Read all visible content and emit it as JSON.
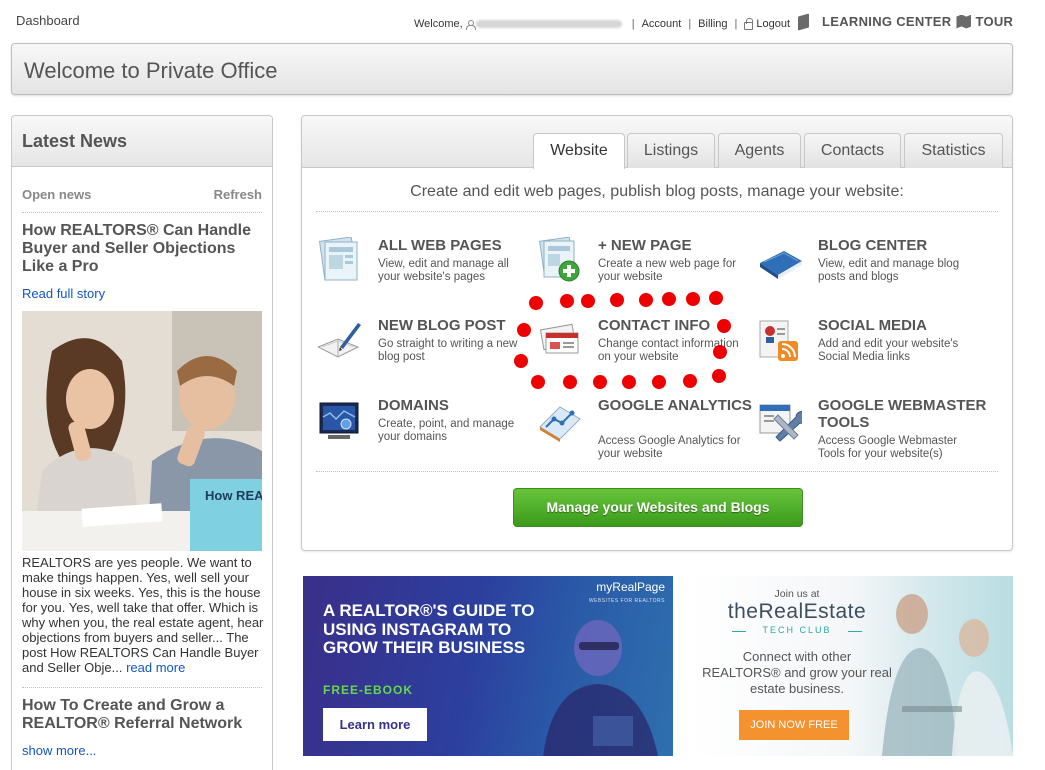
{
  "topbar": {
    "dashboard": "Dashboard",
    "welcome": "Welcome,",
    "account": "Account",
    "billing": "Billing",
    "logout": "Logout",
    "learning_center": "LEARNING CENTER",
    "tour": "TOUR"
  },
  "header": {
    "title": "Welcome to Private Office"
  },
  "news": {
    "heading": "Latest News",
    "open_news": "Open news",
    "refresh": "Refresh",
    "items": [
      {
        "title": "How REALTORS® Can Handle Buyer and Seller Objections Like a Pro",
        "read_link": "Read full story",
        "image_text": "How REALTORS® Handle Buyer Objections",
        "excerpt": "REALTORS are yes people. We want to make things happen. Yes, well sell your house in six weeks. Yes, this is the house for you. Yes, well take that offer. Which is why when you, the real estate agent, hear objections from buyers and seller... The post How REALTORS Can Handle Buyer and Seller Obje...",
        "read_more": "read more"
      },
      {
        "title": "How To Create and Grow a REALTOR® Referral Network"
      }
    ],
    "show_more": "show more..."
  },
  "main": {
    "tabs": [
      {
        "label": "Website",
        "active": true
      },
      {
        "label": "Listings",
        "active": false
      },
      {
        "label": "Agents",
        "active": false
      },
      {
        "label": "Contacts",
        "active": false
      },
      {
        "label": "Statistics",
        "active": false
      }
    ],
    "subtitle": "Create and edit web pages, publish blog posts, manage your website:",
    "features": [
      {
        "title": "ALL WEB PAGES",
        "desc": "View, edit and manage all your website's pages",
        "icon": "pages-icon"
      },
      {
        "title": "+ NEW PAGE",
        "desc": "Create a new web page for your website",
        "icon": "new-page-icon"
      },
      {
        "title": "BLOG CENTER",
        "desc": "View, edit and manage blog posts and blogs",
        "icon": "blog-book-icon"
      },
      {
        "title": "NEW BLOG POST",
        "desc": "Go straight to writing a new blog post",
        "icon": "pen-notebook-icon"
      },
      {
        "title": "CONTACT INFO",
        "desc": "Change contact information on your website",
        "icon": "business-cards-icon"
      },
      {
        "title": "SOCIAL MEDIA",
        "desc": "Add and edit your website's Social Media links",
        "icon": "rss-contact-icon"
      },
      {
        "title": "DOMAINS",
        "desc": "Create, point, and manage your domains",
        "icon": "domain-screen-icon"
      },
      {
        "title": "GOOGLE ANALYTICS",
        "desc": "Access Google Analytics for your website",
        "icon": "analytics-chart-icon"
      },
      {
        "title": "GOOGLE WEBMASTER TOOLS",
        "desc": "Access Google Webmaster Tools for your website(s)",
        "icon": "webmaster-tools-icon"
      }
    ],
    "manage_button": "Manage your Websites and Blogs"
  },
  "ads": {
    "instagram": {
      "brand": "myRealPage",
      "brand_sub": "WEBSITES FOR REALTORS",
      "title": "A REALTOR®'S GUIDE TO USING INSTAGRAM TO GROW THEIR BUSINESS",
      "tag": "FREE-EBOOK",
      "button": "Learn more"
    },
    "techclub": {
      "join": "Join us at",
      "brand": "theRealEstate",
      "club": "TECH CLUB",
      "text": "Connect with other REALTORS® and grow your real estate business.",
      "button": "JOIN NOW FREE"
    }
  },
  "colors": {
    "link": "#1256c4",
    "button_green": "#4aab27",
    "annotation_red": "#ee0000",
    "ad_purple": "#35308a",
    "ad_orange": "#f3922e"
  }
}
